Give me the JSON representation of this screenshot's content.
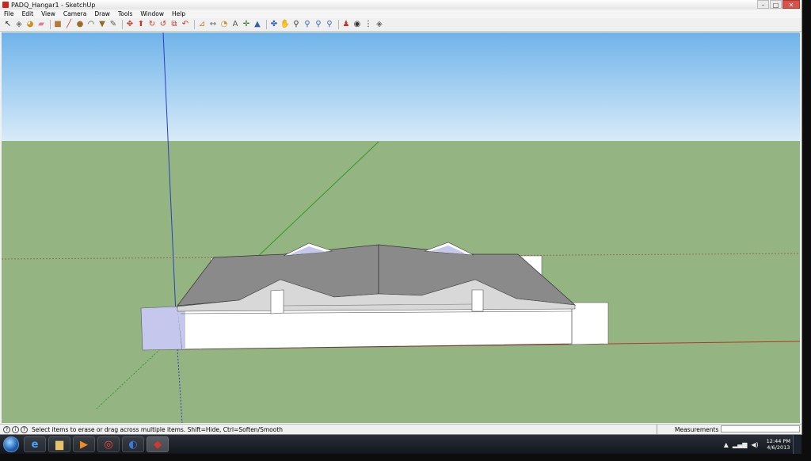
{
  "window": {
    "title": "PADQ_Hangar1 - SketchUp"
  },
  "window_controls": {
    "minimize": "–",
    "maximize": "□",
    "close": "✕"
  },
  "menu": [
    "File",
    "Edit",
    "View",
    "Camera",
    "Draw",
    "Tools",
    "Window",
    "Help"
  ],
  "toolbar": {
    "groups": [
      [
        {
          "name": "select-tool",
          "glyph": "↖",
          "color": "#222222"
        },
        {
          "name": "make-component-tool",
          "glyph": "◈",
          "color": "#777777"
        },
        {
          "name": "paint-bucket-tool",
          "glyph": "◕",
          "color": "#c7921f"
        },
        {
          "name": "eraser-tool",
          "glyph": "▰",
          "color": "#e07b9b"
        }
      ],
      [
        {
          "name": "rectangle-tool",
          "glyph": "■",
          "color": "#b07a3a"
        },
        {
          "name": "line-tool",
          "glyph": "╱",
          "color": "#c0392b"
        },
        {
          "name": "circle-tool",
          "glyph": "●",
          "color": "#a06a2c"
        },
        {
          "name": "arc-tool",
          "glyph": "◠",
          "color": "#444444"
        },
        {
          "name": "polygon-tool",
          "glyph": "▼",
          "color": "#8a6a2c"
        },
        {
          "name": "freehand-tool",
          "glyph": "✎",
          "color": "#555555"
        }
      ],
      [
        {
          "name": "move-tool",
          "glyph": "✥",
          "color": "#c0392b"
        },
        {
          "name": "push-pull-tool",
          "glyph": "⬆",
          "color": "#c0392b"
        },
        {
          "name": "rotate-tool",
          "glyph": "↻",
          "color": "#c0392b"
        },
        {
          "name": "follow-me-tool",
          "glyph": "↺",
          "color": "#c0392b"
        },
        {
          "name": "scale-tool",
          "glyph": "⧉",
          "color": "#c0392b"
        },
        {
          "name": "offset-tool",
          "glyph": "↶",
          "color": "#c0392b"
        }
      ],
      [
        {
          "name": "tape-measure-tool",
          "glyph": "⊿",
          "color": "#b08a2c"
        },
        {
          "name": "dimension-tool",
          "glyph": "↔",
          "color": "#666666"
        },
        {
          "name": "protractor-tool",
          "glyph": "◔",
          "color": "#c7921f"
        },
        {
          "name": "text-tool",
          "glyph": "A",
          "color": "#555555"
        },
        {
          "name": "axes-tool",
          "glyph": "✛",
          "color": "#2a7a2a"
        },
        {
          "name": "3d-text-tool",
          "glyph": "▲",
          "color": "#3b5ca8"
        }
      ],
      [
        {
          "name": "orbit-tool",
          "glyph": "✤",
          "color": "#2f63b8"
        },
        {
          "name": "pan-tool",
          "glyph": "✋",
          "color": "#555555"
        },
        {
          "name": "zoom-tool",
          "glyph": "⚲",
          "color": "#333333"
        },
        {
          "name": "zoom-window-tool",
          "glyph": "⚲",
          "color": "#2f63b8"
        },
        {
          "name": "zoom-extents-tool",
          "glyph": "⚲",
          "color": "#2f63b8"
        },
        {
          "name": "previous-view-tool",
          "glyph": "⚲",
          "color": "#2f63b8"
        }
      ],
      [
        {
          "name": "position-camera-tool",
          "glyph": "♟",
          "color": "#c0392b"
        },
        {
          "name": "look-around-tool",
          "glyph": "◉",
          "color": "#333333"
        },
        {
          "name": "walk-tool",
          "glyph": "⋮",
          "color": "#222222"
        },
        {
          "name": "section-plane-tool",
          "glyph": "◈",
          "color": "#666666"
        }
      ]
    ]
  },
  "status": {
    "message": "Select items to erase or drag across multiple items. Shift=Hide, Ctrl=Soften/Smooth"
  },
  "measurements": {
    "label": "Measurements",
    "value": ""
  },
  "scene": {
    "sky_top": "#6fb3ea",
    "sky_bottom": "#d8ebf8",
    "ground": "#94b582",
    "roof": "#8a8a8a",
    "roof_edge": "#d8d8d8",
    "wall": "#ffffff",
    "wall_shaded": "#c5c8ec"
  },
  "taskbar": {
    "apps": [
      {
        "name": "internet-explorer-icon",
        "glyph": "e",
        "color": "#4aa3ff"
      },
      {
        "name": "file-explorer-icon",
        "glyph": "▆",
        "color": "#e6c46a"
      },
      {
        "name": "media-player-icon",
        "glyph": "▶",
        "color": "#f28c1f"
      },
      {
        "name": "chrome-icon",
        "glyph": "◎",
        "color": "#ef4b3a"
      },
      {
        "name": "google-earth-icon",
        "glyph": "◐",
        "color": "#3a7ad8"
      },
      {
        "name": "sketchup-icon",
        "glyph": "◆",
        "color": "#d2382c"
      }
    ],
    "clock_time": "12:44 PM",
    "clock_date": "4/6/2013"
  }
}
